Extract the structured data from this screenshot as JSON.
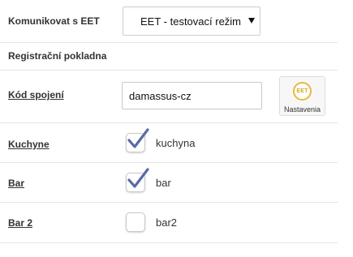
{
  "eet": {
    "label": "Komunikovat s EET",
    "selected": "EET - testovací režim"
  },
  "register": {
    "title": "Registrační pokladna",
    "connection_code_label": "Kód spojení",
    "connection_code_value": "damassus-cz",
    "settings_button_logo": "EET",
    "settings_button_label": "Nastavenia"
  },
  "printers": [
    {
      "label": "Kuchyne",
      "checked": true,
      "value": "kuchyna"
    },
    {
      "label": "Bar",
      "checked": true,
      "value": "bar"
    },
    {
      "label": "Bar 2",
      "checked": false,
      "value": "bar2"
    }
  ],
  "colors": {
    "checkmark": "#5a6aa6",
    "eet_logo": "#e7b93c",
    "divider": "#e6e6e6"
  },
  "icons": {
    "dropdown": "chevron-down-icon",
    "check": "checkmark-icon",
    "eet": "eet-logo-icon"
  }
}
